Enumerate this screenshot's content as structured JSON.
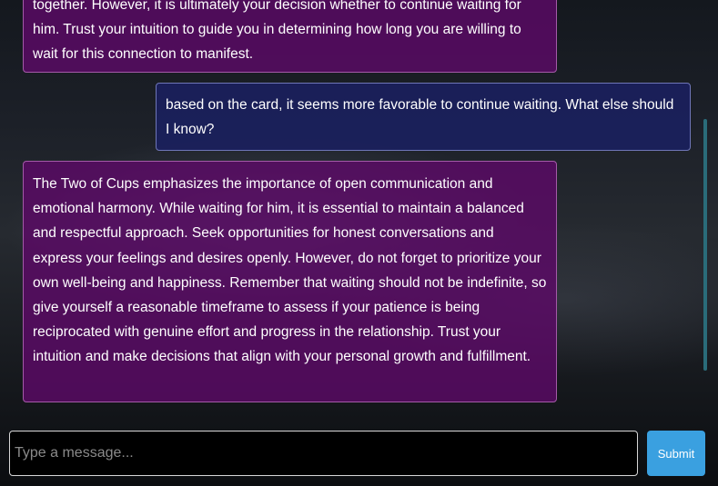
{
  "messages": [
    {
      "role": "assistant",
      "text": "together. However, it is ultimately your decision whether to continue waiting for him. Trust your intuition to guide you in determining how long you are willing to wait for this connection to manifest."
    },
    {
      "role": "user",
      "text": "based on the card, it seems more favorable to continue waiting. What else should I know?"
    },
    {
      "role": "assistant",
      "text": "The Two of Cups emphasizes the importance of open communication and emotional harmony. While waiting for him, it is essential to maintain a balanced and respectful approach. Seek opportunities for honest conversations and express your feelings and desires openly. However, do not forget to prioritize your own well-being and happiness. Remember that waiting should not be indefinite, so give yourself a reasonable timeframe to assess if your patience is being reciprocated with genuine effort and progress in the relationship. Trust your intuition and make decisions that align with your personal growth and fulfillment."
    }
  ],
  "composer": {
    "placeholder": "Type a message...",
    "value": ""
  },
  "submit_label": "Submit",
  "colors": {
    "assistant_bubble": "#5c0a66",
    "user_bubble": "#1a2060",
    "submit_button": "#3aa0e0",
    "scrollbar": "#2a6c7a"
  }
}
